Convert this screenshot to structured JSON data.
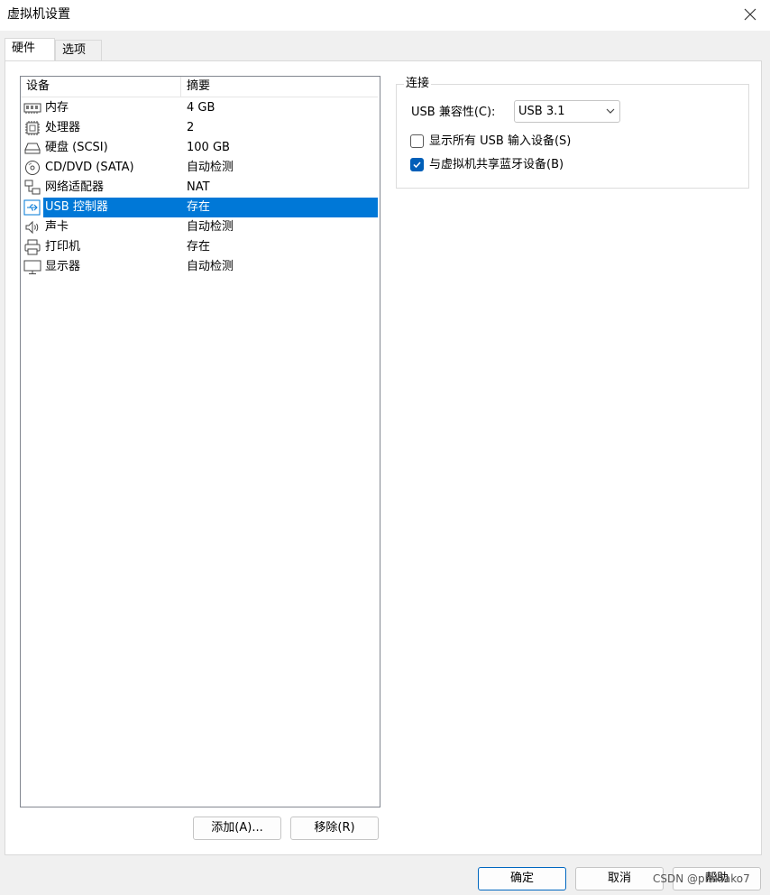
{
  "window": {
    "title": "虚拟机设置"
  },
  "tabs": [
    {
      "label": "硬件",
      "active": true
    },
    {
      "label": "选项",
      "active": false
    }
  ],
  "device_list": {
    "columns": [
      "设备",
      "摘要"
    ],
    "rows": [
      {
        "name": "内存",
        "summary": "4 GB",
        "icon": "memory-icon"
      },
      {
        "name": "处理器",
        "summary": "2",
        "icon": "processor-icon"
      },
      {
        "name": "硬盘 (SCSI)",
        "summary": "100 GB",
        "icon": "hard-disk-icon"
      },
      {
        "name": "CD/DVD (SATA)",
        "summary": "自动检测",
        "icon": "cd-dvd-icon"
      },
      {
        "name": "网络适配器",
        "summary": "NAT",
        "icon": "network-adapter-icon"
      },
      {
        "name": "USB 控制器",
        "summary": "存在",
        "icon": "usb-icon",
        "selected": true
      },
      {
        "name": "声卡",
        "summary": "自动检测",
        "icon": "speaker-icon"
      },
      {
        "name": "打印机",
        "summary": "存在",
        "icon": "printer-icon"
      },
      {
        "name": "显示器",
        "summary": "自动检测",
        "icon": "monitor-icon"
      }
    ]
  },
  "list_buttons": {
    "add": "添加(A)...",
    "remove": "移除(R)"
  },
  "connection": {
    "title": "连接",
    "usb_compat_label": "USB 兼容性(C):",
    "usb_compat_value": "USB 3.1",
    "show_all_usb": {
      "label": "显示所有 USB 输入设备(S)",
      "checked": false
    },
    "share_bluetooth": {
      "label": "与虚拟机共享蓝牙设备(B)",
      "checked": true
    }
  },
  "footer": {
    "ok": "确定",
    "cancel": "取消",
    "help": "帮助"
  },
  "watermark": "CSDN @pinkiako7",
  "colors": {
    "selection": "#0078d7",
    "accent": "#005fb8",
    "primary_border": "#0067c0"
  }
}
